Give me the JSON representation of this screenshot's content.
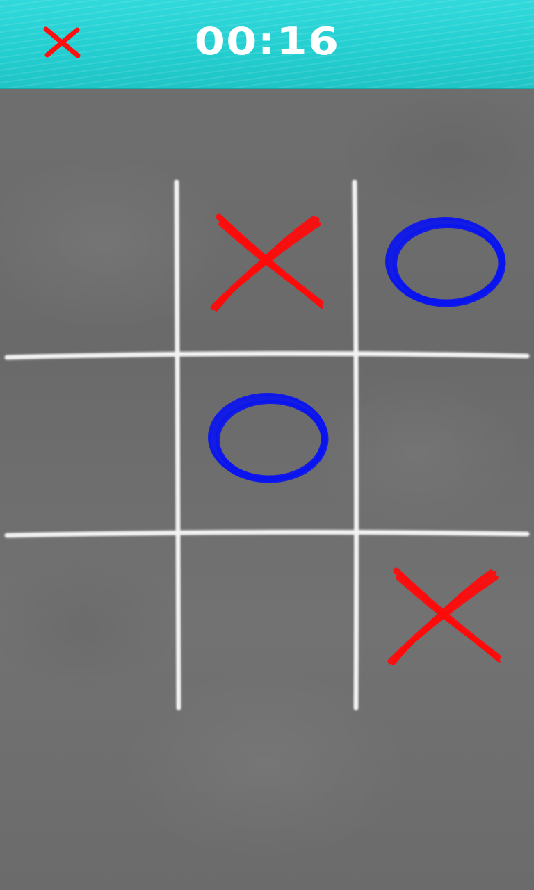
{
  "header": {
    "turn_icon": "x-mark-icon",
    "timer": "00:16"
  },
  "board": {
    "cells": [
      {
        "row": 0,
        "col": 0,
        "mark": ""
      },
      {
        "row": 0,
        "col": 1,
        "mark": "X"
      },
      {
        "row": 0,
        "col": 2,
        "mark": "O"
      },
      {
        "row": 1,
        "col": 0,
        "mark": ""
      },
      {
        "row": 1,
        "col": 1,
        "mark": "O"
      },
      {
        "row": 1,
        "col": 2,
        "mark": ""
      },
      {
        "row": 2,
        "col": 0,
        "mark": ""
      },
      {
        "row": 2,
        "col": 1,
        "mark": ""
      },
      {
        "row": 2,
        "col": 2,
        "mark": "X"
      }
    ]
  },
  "colors": {
    "x_mark": "#ff0a0a",
    "o_mark": "#0a14f0",
    "grid_line": "#f2f2f2",
    "header_bg": "#24cfd1"
  }
}
